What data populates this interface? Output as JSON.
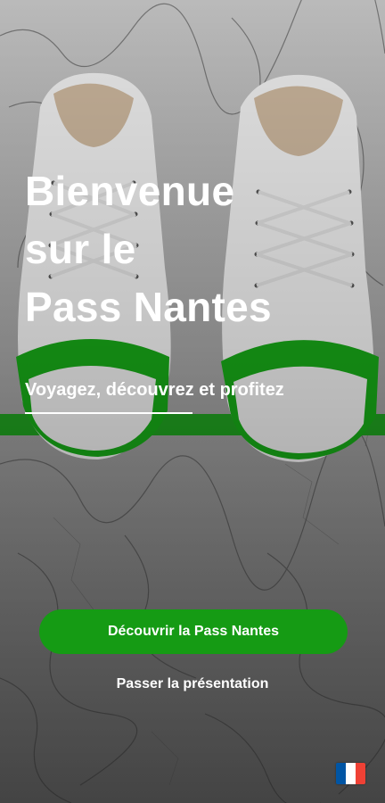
{
  "hero": {
    "title_lines": [
      "Bienvenue",
      "sur le",
      "Pass Nantes"
    ],
    "subtitle": "Voyagez, découvrez et profitez"
  },
  "actions": {
    "discover_label": "Découvrir la Pass Nantes",
    "skip_label": "Passer la présentation"
  },
  "language": {
    "flag_icon": "flag-france-icon",
    "colors": [
      "#0055A4",
      "#FFFFFF",
      "#EF4135"
    ]
  },
  "theme": {
    "accent": "#159b14",
    "text": "#FFFFFF"
  }
}
